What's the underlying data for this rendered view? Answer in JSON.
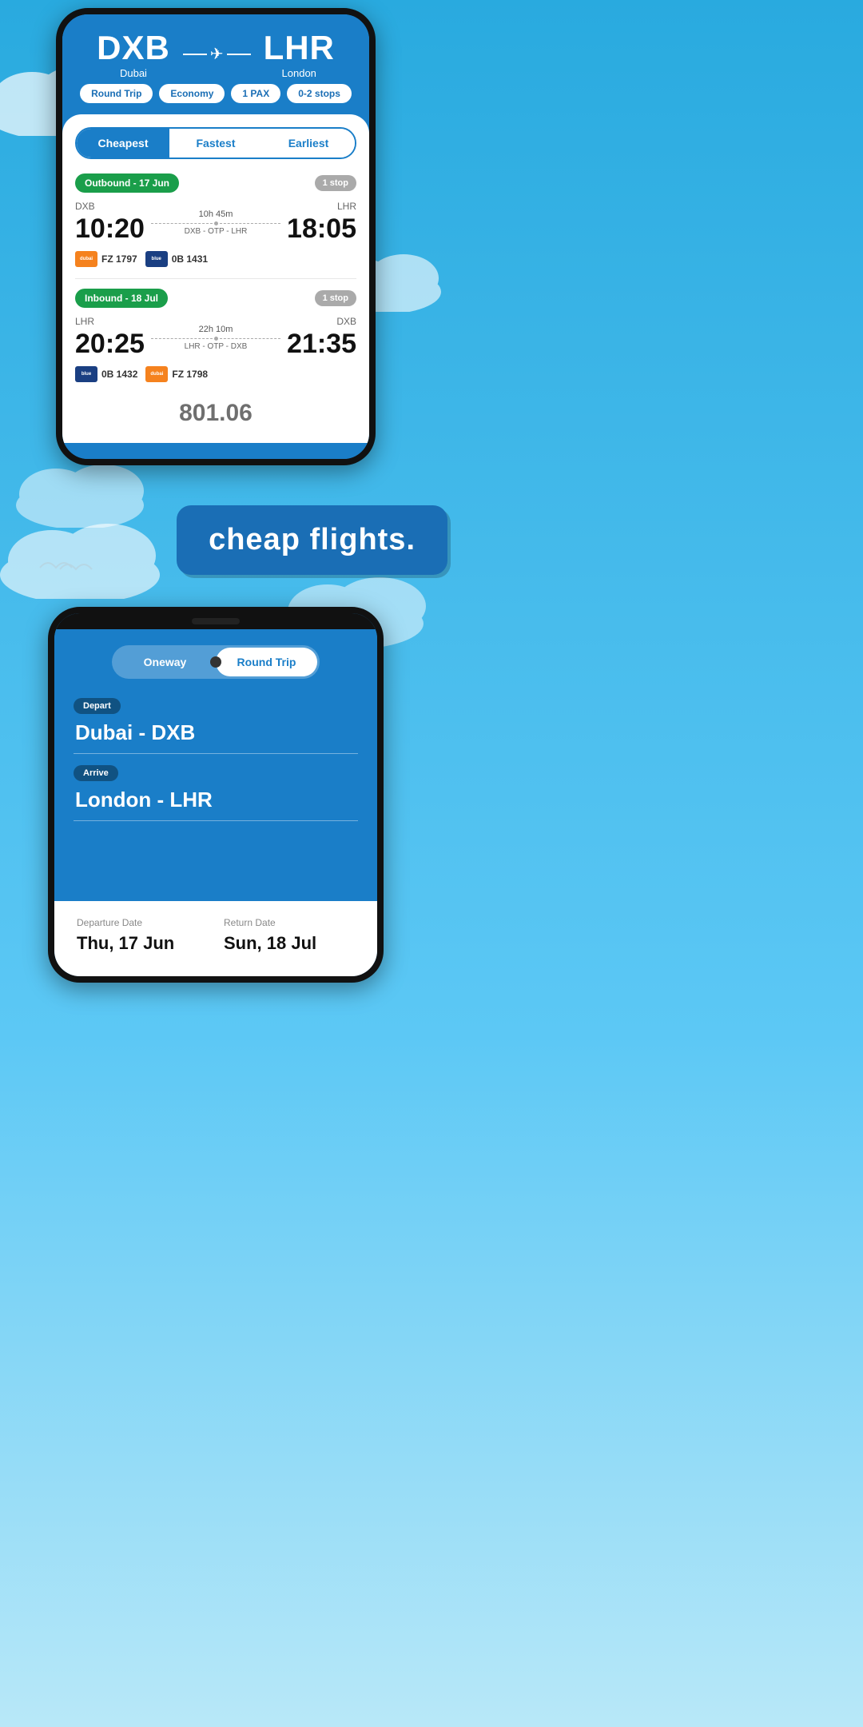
{
  "phone1": {
    "header": {
      "from_code": "DXB",
      "from_city": "Dubai",
      "to_code": "LHR",
      "to_city": "London",
      "filters": {
        "trip_type": "Round Trip",
        "cabin": "Economy",
        "passengers": "1 PAX",
        "stops": "0-2 stops"
      }
    },
    "tabs": {
      "cheapest": "Cheapest",
      "fastest": "Fastest",
      "earliest": "Earliest",
      "active": "cheapest"
    },
    "outbound": {
      "label": "Outbound - 17 Jun",
      "stops": "1 stop",
      "from": "DXB",
      "to": "LHR",
      "depart_time": "10:20",
      "arrive_time": "18:05",
      "duration": "10h 45m",
      "route": "DXB - OTP - LHR",
      "flights": [
        {
          "logo_type": "orange",
          "code": "FZ 1797",
          "text": "dubai"
        },
        {
          "logo_type": "blue",
          "code": "0B 1431",
          "text": "blue"
        }
      ]
    },
    "inbound": {
      "label": "Inbound - 18 Jul",
      "stops": "1 stop",
      "from": "LHR",
      "to": "DXB",
      "depart_time": "20:25",
      "arrive_time": "21:35",
      "duration": "22h 10m",
      "route": "LHR - OTP - DXB",
      "flights": [
        {
          "logo_type": "blue",
          "code": "0B 1432",
          "text": "blue"
        },
        {
          "logo_type": "orange",
          "code": "FZ 1798",
          "text": "dubai"
        }
      ]
    },
    "price_preview": "801.06"
  },
  "middle": {
    "tagline": "cheap flights."
  },
  "phone2": {
    "toggle": {
      "oneway": "Oneway",
      "round_trip": "Round Trip",
      "active": "round_trip"
    },
    "depart_label": "Depart",
    "depart_value": "Dubai - DXB",
    "arrive_label": "Arrive",
    "arrive_value": "London - LHR",
    "departure_date_label": "Departure Date",
    "departure_date_value": "Thu, 17 Jun",
    "return_date_label": "Return Date",
    "return_date_value": "Sun, 18 Jul"
  }
}
